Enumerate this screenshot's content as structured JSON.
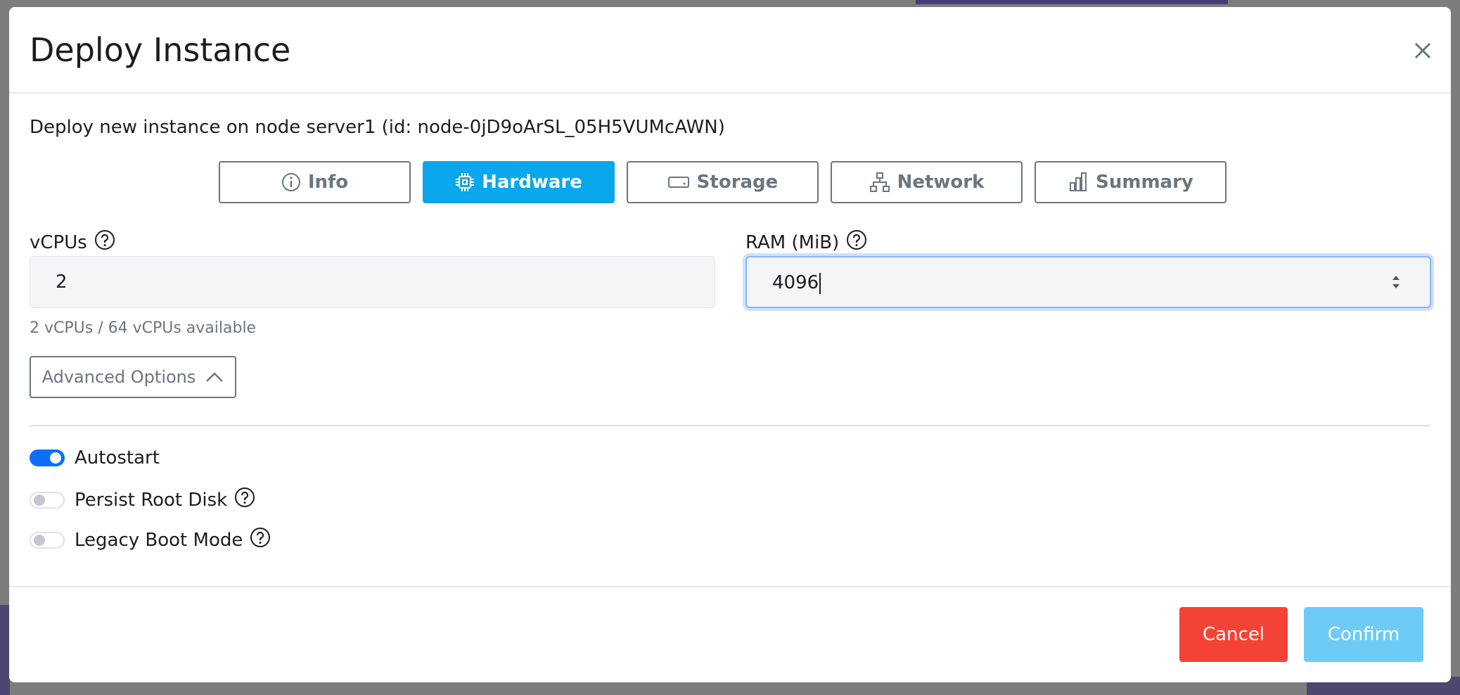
{
  "modal": {
    "title": "Deploy Instance",
    "description": "Deploy new instance on node server1 (id: node-0jD9oArSL_05H5VUMcAWN)"
  },
  "tabs": [
    {
      "label": "Info",
      "icon": "info-circle-icon",
      "active": false
    },
    {
      "label": "Hardware",
      "icon": "cpu-icon",
      "active": true
    },
    {
      "label": "Storage",
      "icon": "hdd-icon",
      "active": false
    },
    {
      "label": "Network",
      "icon": "network-icon",
      "active": false
    },
    {
      "label": "Summary",
      "icon": "bar-chart-icon",
      "active": false
    }
  ],
  "hardware": {
    "vcpus_label": "vCPUs",
    "vcpus_value": "2",
    "vcpus_hint": "2 vCPUs / 64 vCPUs available",
    "ram_label": "RAM (MiB)",
    "ram_value": "4096"
  },
  "advanced": {
    "button_label": "Advanced Options",
    "options": [
      {
        "label": "Autostart",
        "enabled": true,
        "has_help": false
      },
      {
        "label": "Persist Root Disk",
        "enabled": false,
        "has_help": true
      },
      {
        "label": "Legacy Boot Mode",
        "enabled": false,
        "has_help": true
      }
    ]
  },
  "footer": {
    "cancel_label": "Cancel",
    "confirm_label": "Confirm"
  },
  "colors": {
    "accent": "#0aa7ec",
    "danger": "#f44336",
    "confirm_disabled": "#6ecbf6",
    "switch_on": "#0d6efd"
  }
}
